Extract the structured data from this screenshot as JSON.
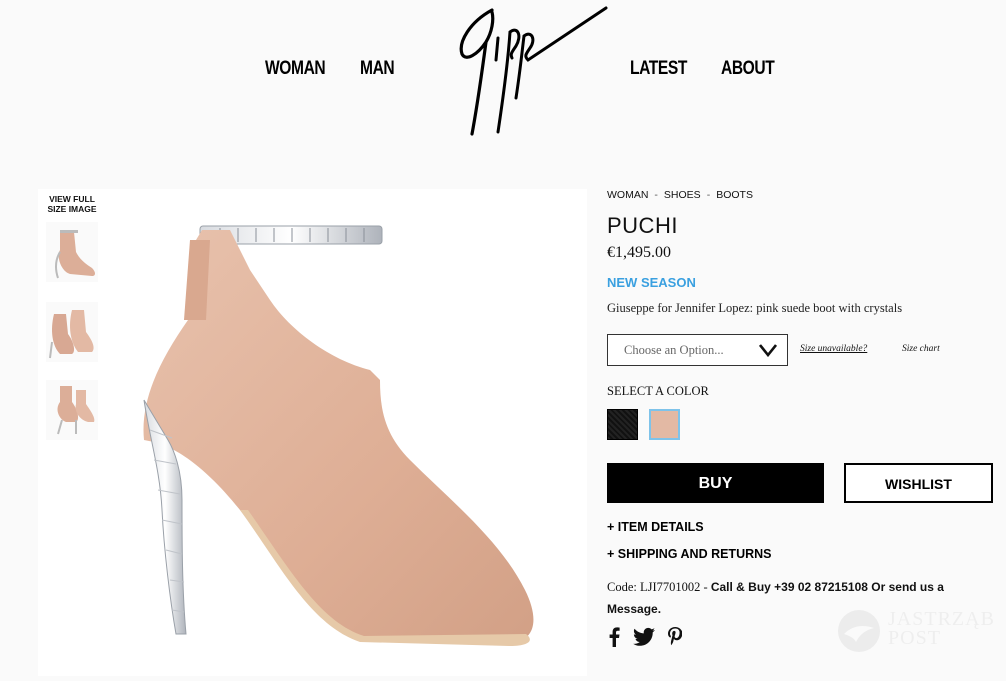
{
  "header": {
    "nav_left": [
      "WOMAN",
      "MAN"
    ],
    "nav_right": [
      "LATEST",
      "ABOUT"
    ],
    "logo_icon": "giuseppe-signature-logo"
  },
  "gallery": {
    "view_full_label": "VIEW FULL SIZE IMAGE",
    "thumbnail_count": 3
  },
  "product": {
    "breadcrumb": [
      "WOMAN",
      "SHOES",
      "BOOTS"
    ],
    "breadcrumb_separator": "-",
    "title": "PUCHI",
    "price": "€1,495.00",
    "season_badge": "NEW SEASON",
    "description": "Giuseppe for Jennifer Lopez: pink suede boot with crystals",
    "size_select_placeholder": "Choose an Option...",
    "size_unavailable": "Size unavailable?",
    "size_chart": "Size chart",
    "select_color_label": "SELECT A COLOR",
    "colors": [
      {
        "name": "black",
        "hex": "#1b1b1b",
        "selected": false
      },
      {
        "name": "pink",
        "hex": "#e3b9a4",
        "selected": true
      }
    ],
    "buy_label": "BUY",
    "wishlist_label": "WISHLIST",
    "item_details_label": "+ ITEM DETAILS",
    "shipping_label": "+ SHIPPING AND RETURNS",
    "code_prefix": "Code: LJI7701002 - ",
    "call_text": "Call & Buy +39 02 87215108 Or send us a Message."
  },
  "social": [
    "facebook-icon",
    "twitter-icon",
    "pinterest-icon"
  ],
  "watermark": [
    "JASTRZĄB",
    "POST"
  ],
  "colors": {
    "accent_blue": "#3aa0e0",
    "buy_bg": "#000000",
    "swatch_selected_border": "#7ec3ea"
  }
}
